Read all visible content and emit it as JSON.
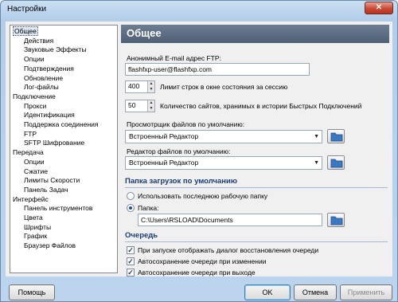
{
  "window": {
    "title": "Настройки",
    "close_glyph": "✕"
  },
  "tree": {
    "items": [
      {
        "label": "Общее",
        "level": 0,
        "selected": true
      },
      {
        "label": "Действия",
        "level": 1
      },
      {
        "label": "Звуковые Эффекты",
        "level": 1
      },
      {
        "label": "Опции",
        "level": 1
      },
      {
        "label": "Подтверждения",
        "level": 1
      },
      {
        "label": "Обновление",
        "level": 1
      },
      {
        "label": "Лог-файлы",
        "level": 1
      },
      {
        "label": "Подключение",
        "level": 0
      },
      {
        "label": "Прокси",
        "level": 1
      },
      {
        "label": "Идентификация",
        "level": 1
      },
      {
        "label": "Поддержка соединения",
        "level": 1
      },
      {
        "label": "FTP",
        "level": 1
      },
      {
        "label": "SFTP Шифрование",
        "level": 1
      },
      {
        "label": "Передача",
        "level": 0
      },
      {
        "label": "Опции",
        "level": 1
      },
      {
        "label": "Сжатие",
        "level": 1
      },
      {
        "label": "Лимиты Скорости",
        "level": 1
      },
      {
        "label": "Панель Задач",
        "level": 1
      },
      {
        "label": "Интерфейс",
        "level": 0
      },
      {
        "label": "Панель инструментов",
        "level": 1
      },
      {
        "label": "Цвета",
        "level": 1
      },
      {
        "label": "Шрифты",
        "level": 1
      },
      {
        "label": "График",
        "level": 1
      },
      {
        "label": "Браузер Файлов",
        "level": 1
      }
    ]
  },
  "panel": {
    "header": "Общее",
    "anon_email_label": "Анонимный E-mail адрес FTP:",
    "anon_email_value": "flashfxp-user@flashfxp.com",
    "status_limit_value": "400",
    "status_limit_label": "Лимит строк в окне состояния за сессию",
    "history_value": "50",
    "history_label": "Количество сайтов, хранимых в истории Быстрых Подключений",
    "viewer_label": "Просмотрщик файлов по умолчанию:",
    "viewer_value": "Встроенный Редактор",
    "editor_label": "Редактор файлов по умолчанию:",
    "editor_value": "Встроенный Редактор",
    "downloads_section": "Папка загрузок по умолчанию",
    "radio_last_folder": "Использовать последнюю рабочую папку",
    "radio_folder": "Папка:",
    "folder_value": "C:\\Users\\RSLOAD\\Documents",
    "queue_section": "Очередь",
    "check_restore": "При запуске отображать диалог восстановления очереди",
    "check_autosave_change": "Автосохранение очереди при изменении",
    "check_autosave_exit": "Автосохранение очереди при выходе",
    "check_mark": "✓"
  },
  "buttons": {
    "help": "Помощь",
    "ok": "OK",
    "cancel": "Отмена",
    "apply": "Применить"
  },
  "icons": {
    "dropdown": "▼",
    "spin_up": "▲",
    "spin_down": "▼"
  }
}
